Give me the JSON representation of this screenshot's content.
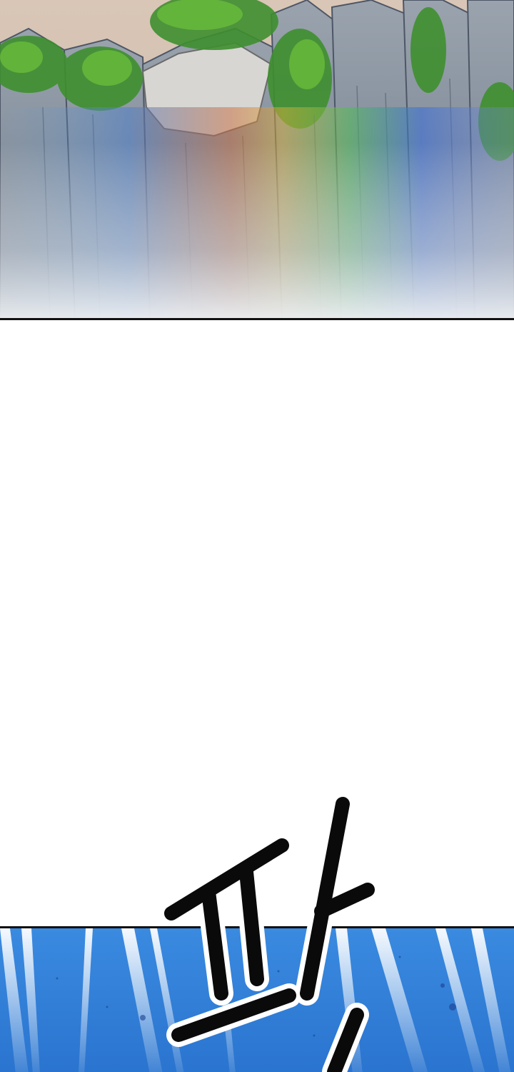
{
  "comic": {
    "panels": [
      {
        "name": "cliff-rainbow-panel",
        "description_icon": "rainbow-cliff-scene"
      },
      {
        "name": "blue-water-panel",
        "description_icon": "splashing-water-scene"
      }
    ],
    "sfx": {
      "text": "파"
    }
  },
  "colors": {
    "background": "#ffffff",
    "border": "#111111",
    "water": "#2d7fd6",
    "sfx_fill": "#0a0a0a",
    "sfx_outline": "#ffffff"
  }
}
